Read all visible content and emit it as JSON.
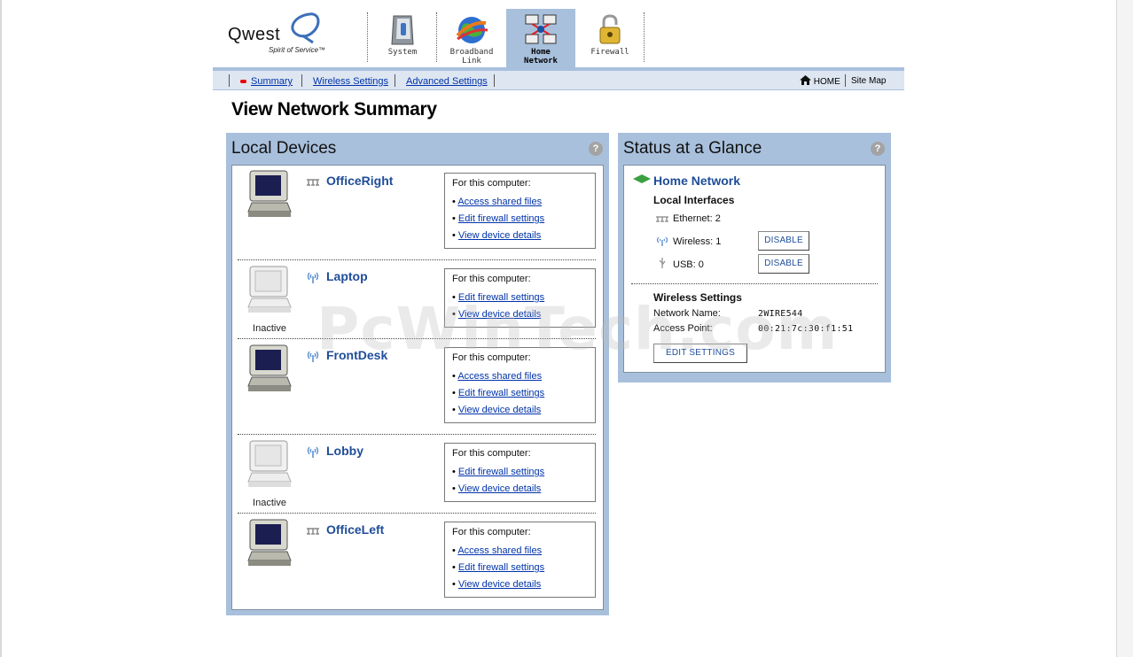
{
  "brand": {
    "name": "Qwest",
    "tagline": "Spirit of Service™"
  },
  "nav_tabs": [
    {
      "label": "System",
      "icon": "system-icon",
      "active": false
    },
    {
      "label": "Broadband\nLink",
      "icon": "globe-icon",
      "active": false
    },
    {
      "label": "Home\nNetwork",
      "icon": "network-icon",
      "active": true
    },
    {
      "label": "Firewall",
      "icon": "padlock-icon",
      "active": false
    }
  ],
  "subnav": {
    "links": [
      "Summary",
      "Wireless Settings",
      "Advanced Settings"
    ],
    "home_label": "HOME",
    "sitemap_label": "Site Map"
  },
  "page_title": "View Network Summary",
  "local_devices": {
    "title": "Local Devices",
    "box_header": "For this computer:",
    "devices": [
      {
        "name": "OfficeRight",
        "connection": "ethernet",
        "inactive": false,
        "links": [
          "Access shared files",
          "Edit firewall settings",
          "View device details"
        ]
      },
      {
        "name": "Laptop",
        "connection": "wireless",
        "inactive": true,
        "status": "Inactive",
        "links": [
          "Edit firewall settings",
          "View device details"
        ]
      },
      {
        "name": "FrontDesk",
        "connection": "wireless",
        "inactive": false,
        "links": [
          "Access shared files",
          "Edit firewall settings",
          "View device details"
        ]
      },
      {
        "name": "Lobby",
        "connection": "wireless",
        "inactive": true,
        "status": "Inactive",
        "links": [
          "Edit firewall settings",
          "View device details"
        ]
      },
      {
        "name": "OfficeLeft",
        "connection": "ethernet",
        "inactive": false,
        "links": [
          "Access shared files",
          "Edit firewall settings",
          "View device details"
        ]
      }
    ]
  },
  "status": {
    "title": "Status at a Glance",
    "home_network": "Home Network",
    "local_interfaces": "Local Interfaces",
    "ethernet": "Ethernet: 2",
    "wireless": "Wireless: 1",
    "usb": "USB: 0",
    "disable_label": "DISABLE",
    "wireless_settings": "Wireless Settings",
    "network_name_label": "Network Name:",
    "network_name": "2WIRE544",
    "access_point_label": "Access Point:",
    "access_point": "00:21:7c:30:f1:51",
    "edit_settings_label": "EDIT SETTINGS"
  },
  "watermark": "PcWinTech.com",
  "colors": {
    "panel": "#a8c0dc",
    "link": "#0033aa",
    "device_name": "#1f4d99",
    "subnav_bg": "#dde6f1"
  }
}
